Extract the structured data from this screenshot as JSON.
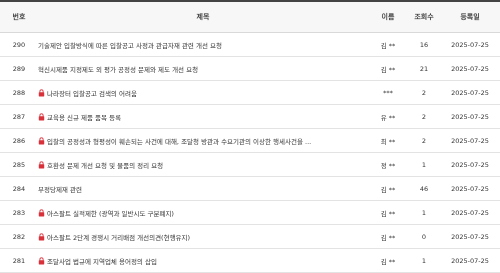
{
  "headers": {
    "num": "번호",
    "title": "제목",
    "name": "이름",
    "views": "조회수",
    "date": "등록일"
  },
  "rows": [
    {
      "num": "290",
      "locked": false,
      "title": "기술제안 입찰방식에 따른 입찰공고 사정과 관급자재 관련 개선 요청",
      "name": "김 **",
      "views": "16",
      "date": "2025-07-25"
    },
    {
      "num": "289",
      "locked": false,
      "title": "혁신시제품 지정제도 외 평가 공정성 문제와 제도 개선 요청",
      "name": "김 **",
      "views": "21",
      "date": "2025-07-25"
    },
    {
      "num": "288",
      "locked": true,
      "title": "나라장터 입찰공고 검색의 어려움",
      "name": "***",
      "views": "2",
      "date": "2025-07-25"
    },
    {
      "num": "287",
      "locked": true,
      "title": "교육용 신규 제품 품목 등록",
      "name": "유 **",
      "views": "2",
      "date": "2025-07-25"
    },
    {
      "num": "286",
      "locked": true,
      "title": "입찰의 공정성과 형평성이 훼손되는 사건에 대해, 조달청 방관과 수요기관의 이상한 행세사건을 ...",
      "name": "최 **",
      "views": "2",
      "date": "2025-07-25"
    },
    {
      "num": "285",
      "locked": true,
      "title": "호환성 문제 개선 요청 및 물품의 정리 요청",
      "name": "정 **",
      "views": "1",
      "date": "2025-07-25"
    },
    {
      "num": "284",
      "locked": false,
      "title": "부정당제재 관련",
      "name": "김 **",
      "views": "46",
      "date": "2025-07-25"
    },
    {
      "num": "283",
      "locked": true,
      "title": "아스팔트 실적제한 (광역과 일반시도 구분폐지)",
      "name": "김 **",
      "views": "1",
      "date": "2025-07-25"
    },
    {
      "num": "282",
      "locked": true,
      "title": "아스팔트 2단계 경쟁시 거리배점 개선의견(현행유지)",
      "name": "김 **",
      "views": "0",
      "date": "2025-07-25"
    },
    {
      "num": "281",
      "locked": true,
      "title": "조달사업 법규에 지역업체 용어정의 삽입",
      "name": "김 **",
      "views": "1",
      "date": "2025-07-25"
    }
  ]
}
